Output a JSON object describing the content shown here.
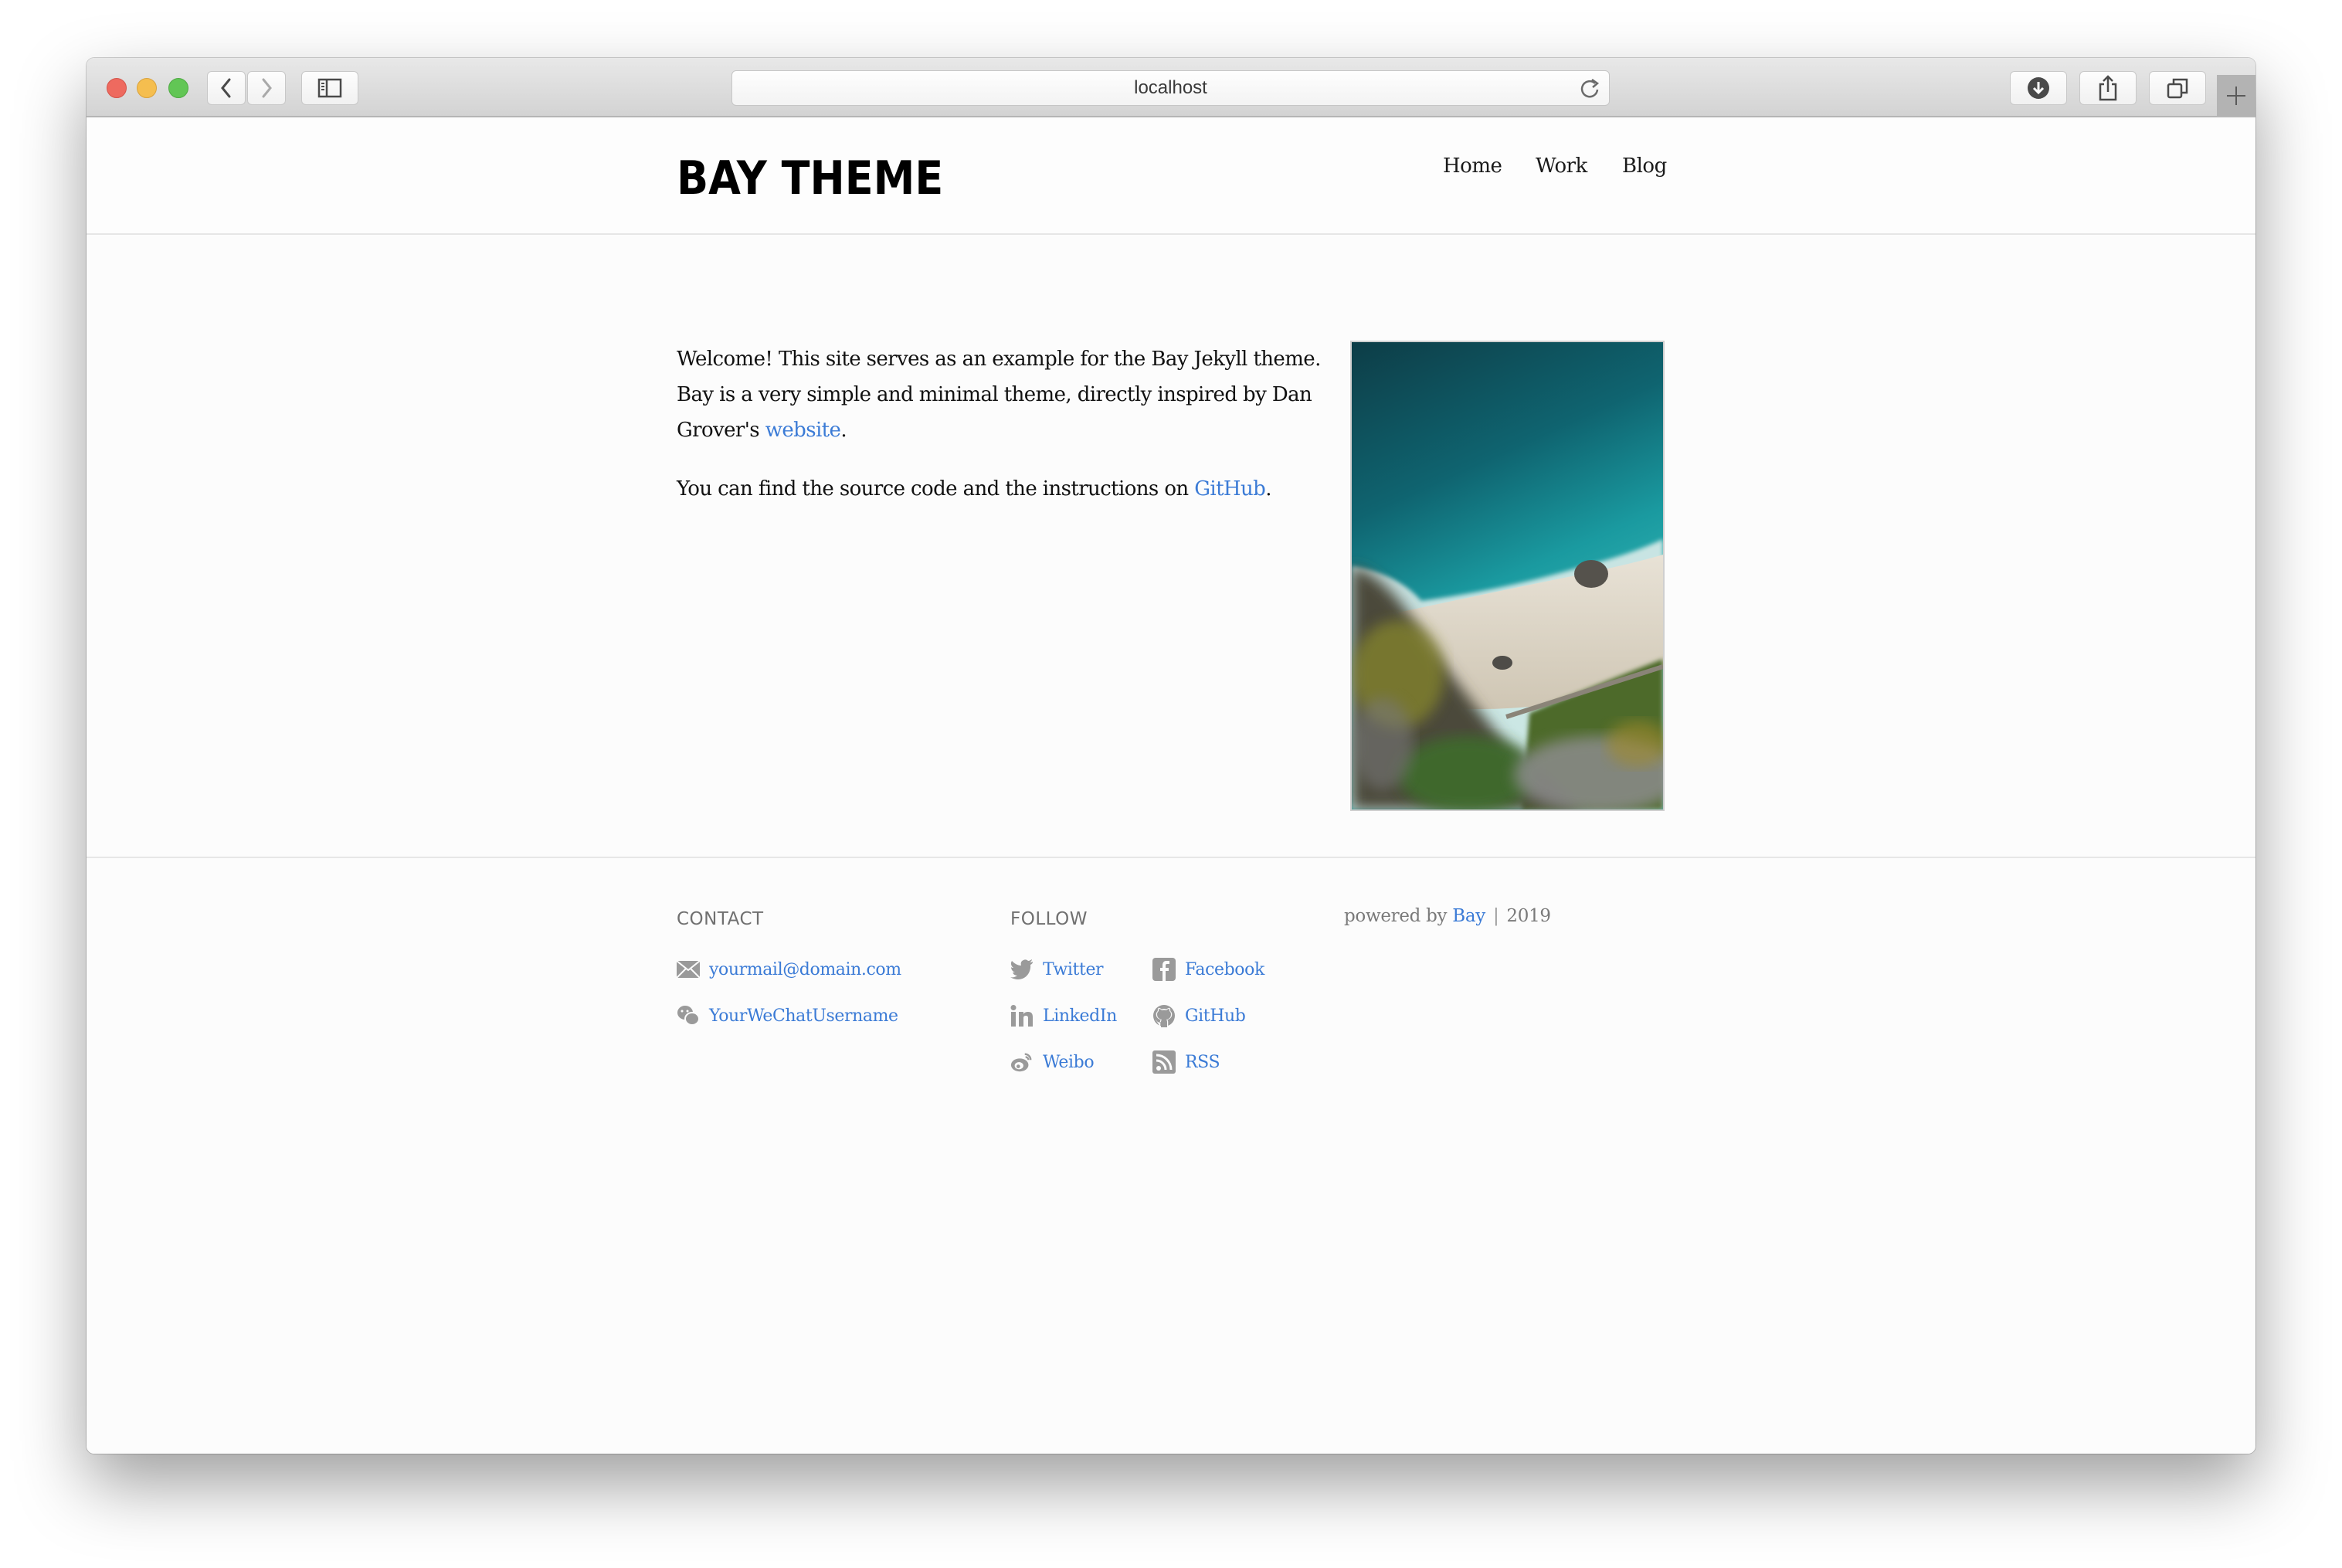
{
  "browser": {
    "url": "localhost",
    "buttons": {
      "back": "back",
      "forward": "forward",
      "sidebar": "sidebar",
      "reload": "reload",
      "downloads": "downloads",
      "share": "share",
      "tabs": "show-all-tabs",
      "new_tab": "new-tab"
    }
  },
  "header": {
    "site_title": "BAY THEME",
    "nav": [
      {
        "label": "Home"
      },
      {
        "label": "Work"
      },
      {
        "label": "Blog"
      }
    ]
  },
  "main": {
    "paragraph1_text": "Welcome! This site serves as an example for the Bay Jekyll theme. Bay is a very simple and minimal theme, directly inspired by Dan Grover's ",
    "paragraph1_link": "website",
    "paragraph1_end": ".",
    "paragraph2_text": "You can find the source code and the instructions on ",
    "paragraph2_link": "GitHub",
    "paragraph2_end": ".",
    "image_alt": "Aerial view of a turquoise sea and sandy beach below a rocky cliff"
  },
  "footer": {
    "contact": {
      "heading": "CONTACT",
      "items": [
        {
          "icon": "mail-icon",
          "label": "yourmail@domain.com"
        },
        {
          "icon": "wechat-icon",
          "label": "YourWeChatUsername"
        }
      ]
    },
    "follow": {
      "heading": "FOLLOW",
      "items": [
        {
          "icon": "twitter-icon",
          "label": "Twitter"
        },
        {
          "icon": "facebook-icon",
          "label": "Facebook"
        },
        {
          "icon": "linkedin-icon",
          "label": "LinkedIn"
        },
        {
          "icon": "github-icon",
          "label": "GitHub"
        },
        {
          "icon": "weibo-icon",
          "label": "Weibo"
        },
        {
          "icon": "rss-icon",
          "label": "RSS"
        }
      ]
    },
    "powered_prefix": "powered by",
    "powered_link": "Bay",
    "separator": "|",
    "year": "2019"
  },
  "colors": {
    "link": "#3b7bd6",
    "icon_gray": "#9a9a9a",
    "text": "#111111",
    "muted": "#7a7a7a"
  }
}
